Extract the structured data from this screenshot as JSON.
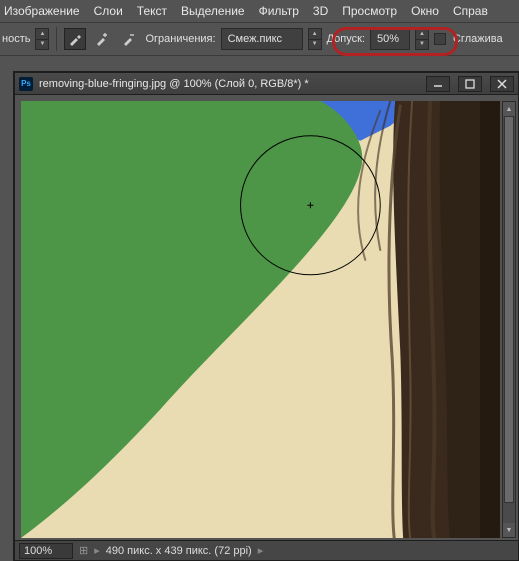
{
  "menubar": {
    "image": "Изображение",
    "layers": "Слои",
    "text": "Текст",
    "selection": "Выделение",
    "filter": "Фильтр",
    "threed": "3D",
    "view": "Просмотр",
    "window": "Окно",
    "help": "Справ"
  },
  "optionsbar": {
    "partial_left": "ность",
    "constraints_label": "Ограничения:",
    "constraints_value": "Смеж.пикс",
    "tolerance_label": "Допуск:",
    "tolerance_value": "50%",
    "smooth_label": "Сглажива"
  },
  "document": {
    "title": "removing-blue-fringing.jpg @ 100% (Слой 0, RGB/8*) *"
  },
  "statusbar": {
    "zoom": "100%",
    "info": "490 пикс. x 439 пикс. (72 ppi)"
  }
}
